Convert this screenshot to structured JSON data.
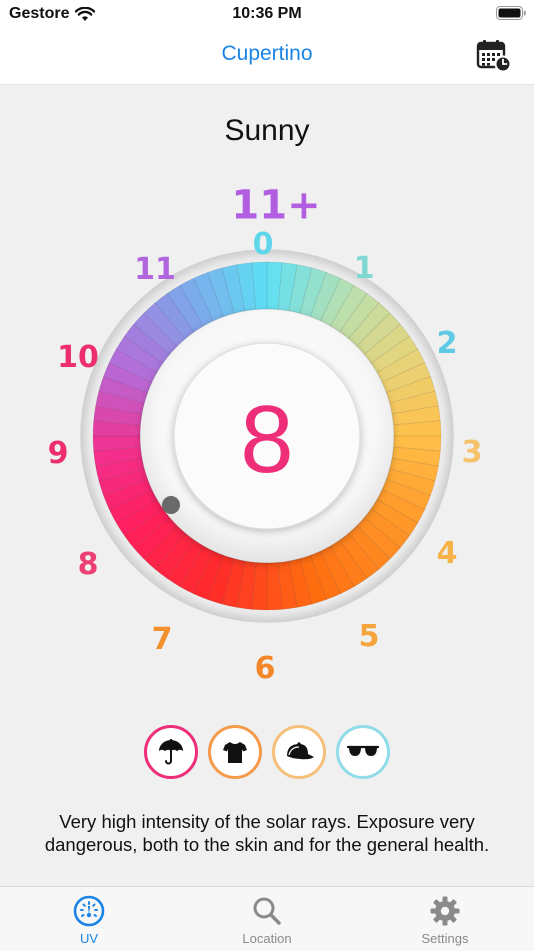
{
  "status_bar": {
    "carrier": "Gestore",
    "time": "10:36 PM"
  },
  "nav": {
    "title": "Cupertino",
    "calendar_icon": "calendar-clock-icon"
  },
  "weather": {
    "condition": "Sunny"
  },
  "uv_dial": {
    "current_value": "8",
    "scale_labels": [
      {
        "text": "11+",
        "color": "#b15fe0"
      },
      {
        "text": "0",
        "color": "#5fd6ea"
      },
      {
        "text": "1",
        "color": "#7fd8d3"
      },
      {
        "text": "2",
        "color": "#5fc9e6"
      },
      {
        "text": "3",
        "color": "#f5c26a"
      },
      {
        "text": "4",
        "color": "#f7b24a"
      },
      {
        "text": "5",
        "color": "#f7a43c"
      },
      {
        "text": "6",
        "color": "#f4862a"
      },
      {
        "text": "7",
        "color": "#f4902e"
      },
      {
        "text": "8",
        "color": "#ec3f76"
      },
      {
        "text": "9",
        "color": "#ec2e70"
      },
      {
        "text": "10",
        "color": "#ec2e70"
      },
      {
        "text": "11",
        "color": "#b166e0"
      }
    ],
    "value_color": "#ee2e78"
  },
  "advice": [
    {
      "icon": "umbrella-icon",
      "color": "#ee2e78"
    },
    {
      "icon": "tshirt-icon",
      "color": "#f49a4a"
    },
    {
      "icon": "cap-icon",
      "color": "#f5c07a"
    },
    {
      "icon": "sunglasses-icon",
      "color": "#8fdce8"
    }
  ],
  "description": "Very high intensity of the solar rays. Exposure very dangerous, both to the skin and for the general health.",
  "tabs": [
    {
      "label": "UV",
      "icon": "gauge-icon",
      "active": true
    },
    {
      "label": "Location",
      "icon": "search-icon",
      "active": false
    },
    {
      "label": "Settings",
      "icon": "gear-icon",
      "active": false
    }
  ],
  "colors": {
    "accent": "#1a84e5"
  }
}
